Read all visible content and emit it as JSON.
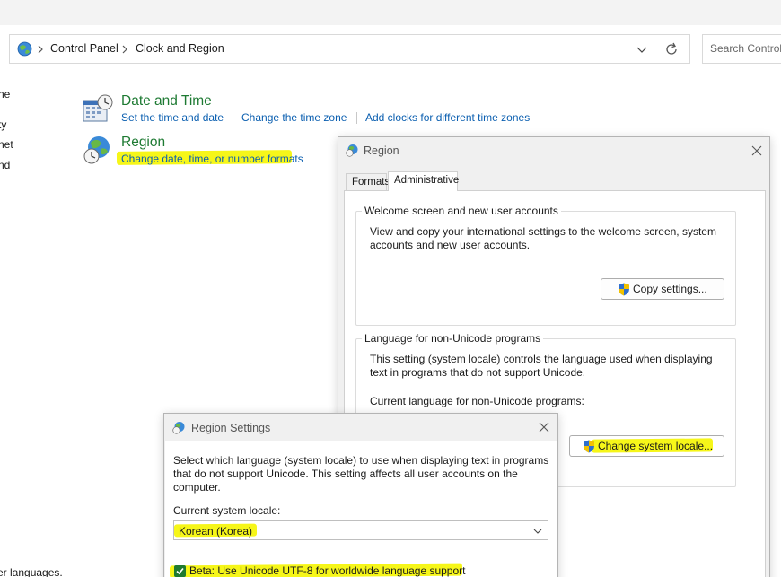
{
  "address": {
    "crumbs": [
      "Control Panel",
      "Clock and Region"
    ],
    "icons": [
      "control-panel-globe-icon",
      "chevron-right-icon",
      "chevron-down-icon",
      "refresh-icon"
    ]
  },
  "search": {
    "placeholder": "Search Control Panel"
  },
  "left_nav": [
    "ne",
    "ty",
    "net",
    "nd"
  ],
  "categories": {
    "datetime": {
      "title": "Date and Time",
      "links": [
        "Set the time and date",
        "Change the time zone",
        "Add clocks for different time zones"
      ]
    },
    "region": {
      "title": "Region",
      "links": [
        "Change date, time, or number formats"
      ]
    }
  },
  "region_dialog": {
    "title": "Region",
    "tabs": [
      "Formats",
      "Administrative"
    ],
    "active_tab": "Administrative",
    "welcome": {
      "legend": "Welcome screen and new user accounts",
      "text": "View and copy your international settings to the welcome screen, system accounts and new user accounts.",
      "button": "Copy settings..."
    },
    "nonunicode": {
      "legend": "Language for non-Unicode programs",
      "text": "This setting (system locale) controls the language used when displaying text in programs that do not support Unicode.",
      "current_label": "Current language for non-Unicode programs:",
      "button": "Change system locale..."
    }
  },
  "region_settings_dialog": {
    "title": "Region Settings",
    "description": "Select which language (system locale) to use when displaying text in programs that do not support Unicode. This setting affects all user accounts on the computer.",
    "locale_label": "Current system locale:",
    "locale_value": "Korean (Korea)",
    "beta_label": "Beta: Use Unicode UTF-8 for worldwide language support",
    "beta_checked": true
  },
  "background_text": "er languages.",
  "colors": {
    "highlight": "#f5f500",
    "link": "#0b5fb0",
    "category_title": "#1e7a33",
    "checkbox": "#1f7a2f"
  }
}
